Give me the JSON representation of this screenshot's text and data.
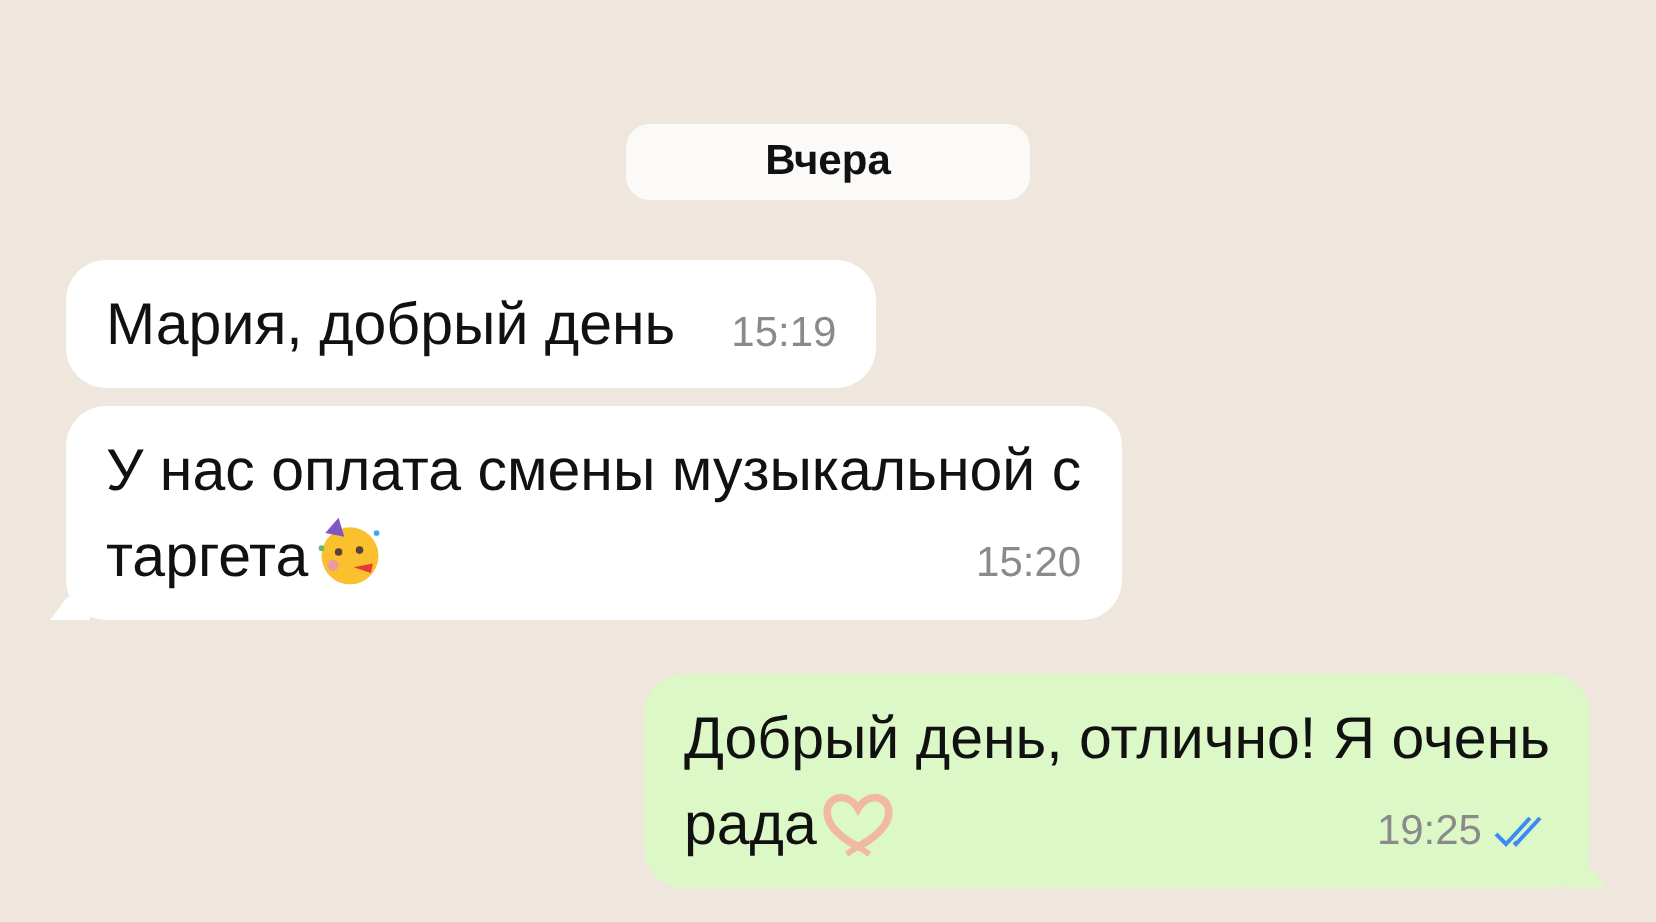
{
  "date_label": "Вчера",
  "messages": [
    {
      "kind": "incoming",
      "lines": [
        "Мария, добрый день"
      ],
      "time": "15:19",
      "tail": false
    },
    {
      "kind": "incoming",
      "lines": [
        "У нас оплата смены музыкальной с",
        "таргета"
      ],
      "emoji": {
        "kind": "party-face"
      },
      "time": "15:20",
      "tail": true
    },
    {
      "kind": "outgoing",
      "lines": [
        "Добрый день, отлично! Я очень",
        "рада"
      ],
      "emoji": {
        "kind": "heart-hands"
      },
      "time": "19:25",
      "tail": true,
      "read": true
    }
  ]
}
